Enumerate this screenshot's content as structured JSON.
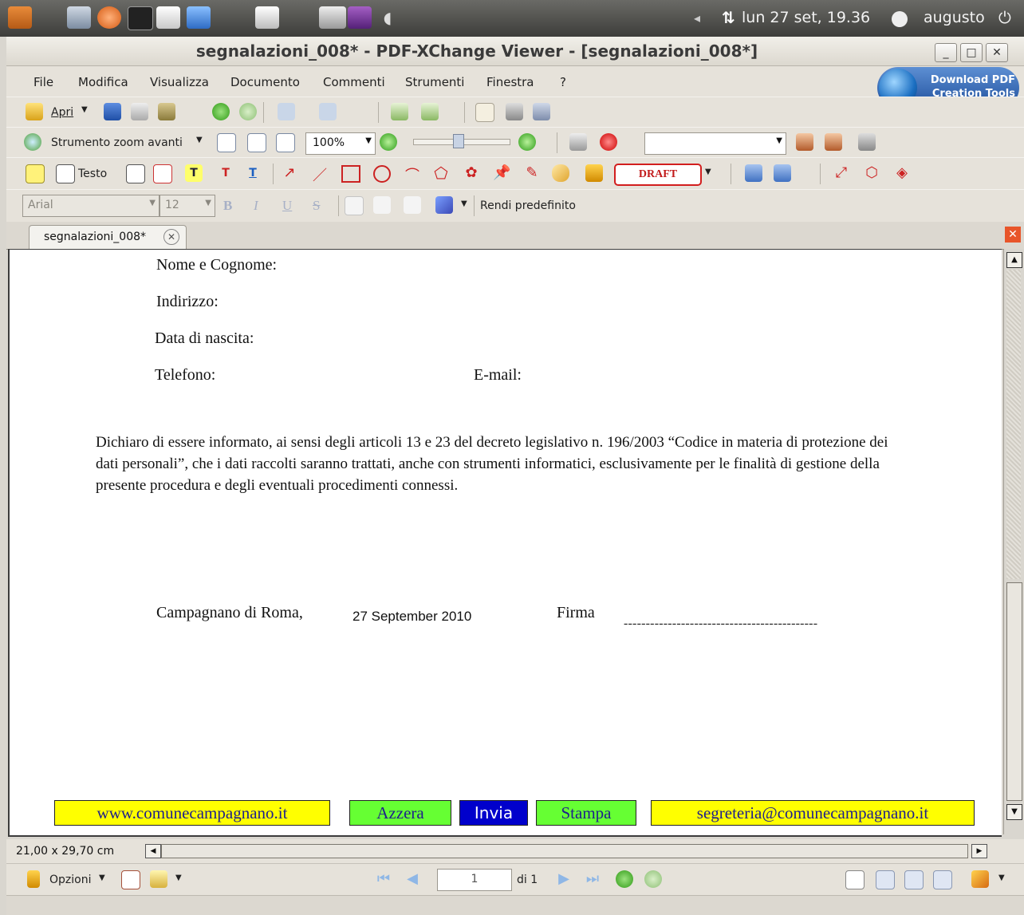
{
  "system_panel": {
    "clock": "lun 27 set, 19.36",
    "user": "augusto"
  },
  "window": {
    "title": "segnalazioni_008* - PDF-XChange Viewer - [segnalazioni_008*]"
  },
  "menu": [
    "File",
    "Modifica",
    "Visualizza",
    "Documento",
    "Commenti",
    "Strumenti",
    "Finestra",
    "?"
  ],
  "banner": {
    "line1": "Download PDF",
    "line2": "Creation Tools"
  },
  "toolbar1": {
    "open_label": "Apri"
  },
  "toolbar2": {
    "zoom_tool_label": "Strumento zoom avanti",
    "zoom_value": "100%"
  },
  "toolbar3": {
    "text_label": "Testo",
    "stamp_label": "DRAFT"
  },
  "toolbar4": {
    "font": "Arial",
    "font_size": "12",
    "default_label": "Rendi predefinito"
  },
  "tab": {
    "label": "segnalazioni_008*"
  },
  "document": {
    "name_label": "Nome e Cognome:",
    "address_label": "Indirizzo:",
    "birth_label": "Data di nascita:",
    "phone_label": "Telefono:",
    "email_label": "E-mail:",
    "disclaimer": "Dichiaro di essere informato, ai sensi degli articoli 13 e 23 del decreto legislativo n. 196/2003 “Codice in materia di protezione dei dati personali”, che i dati raccolti saranno trattati, anche con strumenti informatici, esclusivamente per le finalità di gestione della presente procedura e degli eventuali procedimenti connessi.",
    "place": "Campagnano di Roma,",
    "date": "27 September 2010",
    "signature_label": "Firma",
    "signature_line": "--------------------------------------------",
    "buttons": {
      "website": "www.comunecampagnano.it",
      "reset": "Azzera",
      "send": "Invia",
      "print": "Stampa",
      "email": "segreteria@comunecampagnano.it"
    }
  },
  "status": {
    "page_size": "21,00 x 29,70 cm",
    "options_label": "Opzioni",
    "current_page": "1",
    "page_total": "di 1"
  },
  "colors": {
    "yellow_button": "#ffff00",
    "green_button": "#66ff33",
    "blue_button": "#0000cc"
  }
}
